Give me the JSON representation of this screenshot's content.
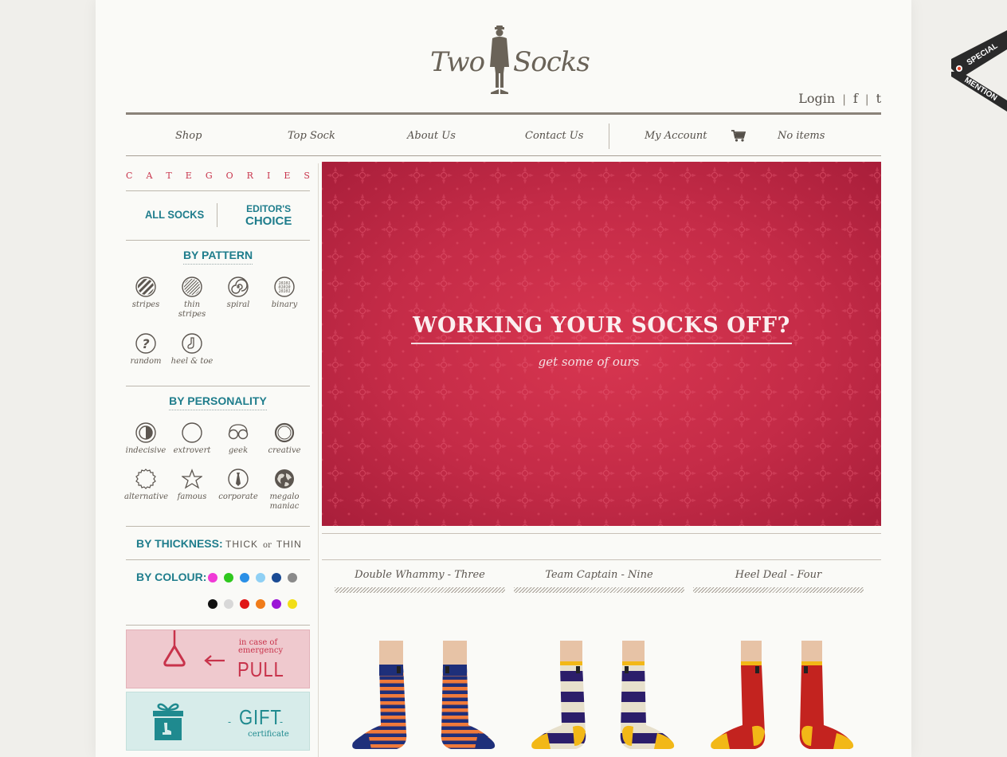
{
  "brand": {
    "name_left": "Two",
    "name_right": "Socks"
  },
  "header": {
    "login": "Login",
    "social": [
      "f",
      "t"
    ]
  },
  "nav": {
    "items": [
      "Shop",
      "Top Sock",
      "About Us",
      "Contact Us",
      "My Account"
    ],
    "cart": "No items"
  },
  "sidebar": {
    "categories_title": [
      "C",
      "A",
      "T",
      "E",
      "G",
      "O",
      "R",
      "I",
      "E",
      "S"
    ],
    "all_socks": "ALL SOCKS",
    "editors_top": "EDITOR'S",
    "editors_bottom": "CHOICE",
    "by_pattern": "BY PATTERN",
    "patterns": [
      {
        "label": "stripes",
        "icon": "stripes-icon"
      },
      {
        "label": "thin stripes",
        "icon": "thin-stripes-icon"
      },
      {
        "label": "spiral",
        "icon": "spiral-icon"
      },
      {
        "label": "binary",
        "icon": "binary-icon"
      },
      {
        "label": "random",
        "icon": "question-icon"
      },
      {
        "label": "heel & toe",
        "icon": "heel-toe-icon"
      }
    ],
    "by_personality": "BY PERSONALITY",
    "personalities": [
      {
        "label": "indecisive",
        "icon": "half-circle-icon"
      },
      {
        "label": "extrovert",
        "icon": "circle-icon"
      },
      {
        "label": "geek",
        "icon": "glasses-icon"
      },
      {
        "label": "creative",
        "icon": "brush-circle-icon"
      },
      {
        "label": "alternative",
        "icon": "badge-icon"
      },
      {
        "label": "famous",
        "icon": "star-icon"
      },
      {
        "label": "corporate",
        "icon": "tie-icon"
      },
      {
        "label": "megalo maniac",
        "icon": "globe-icon"
      }
    ],
    "by_thickness": "BY THICKNESS:",
    "thick": "THICK",
    "or": "or",
    "thin": "THIN",
    "by_colour": "BY COLOUR:",
    "colours": [
      "#f03ad6",
      "#2fc81e",
      "#2a8fe6",
      "#8fd0f4",
      "#1a4b94",
      "#8a8a8a",
      "#111111",
      "#d8d8d8",
      "#e01717",
      "#f07c1a",
      "#9b16d6",
      "#f2de17"
    ],
    "pull": {
      "small": "in case of emergency",
      "big": "PULL"
    },
    "gift": {
      "big": "GIFT",
      "small": "certificate"
    }
  },
  "banner": {
    "headline": "WORKING YOUR SOCKS OFF?",
    "sub": "get some of ours"
  },
  "products": [
    {
      "title": "Double Whammy - Three"
    },
    {
      "title": "Team Captain - Nine"
    },
    {
      "title": "Heel Deal - Four"
    }
  ],
  "ribbon": {
    "line1": "SPECIAL",
    "line2": "MENTION"
  },
  "colors": {
    "accent_red": "#c8334b",
    "teal": "#1f7d8c",
    "banner": "#c42b47"
  }
}
